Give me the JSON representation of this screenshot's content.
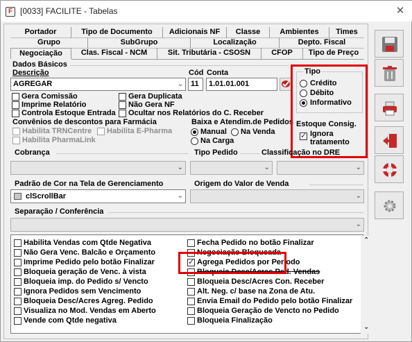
{
  "window": {
    "title": "[0033] FACILITE - Tabelas",
    "close_glyph": "✕"
  },
  "tabs": {
    "row1": [
      "Portador",
      "Tipo de Documento",
      "Adicionais NF",
      "Classe",
      "Ambientes",
      "Times"
    ],
    "row2": [
      "Grupo",
      "SubGrupo",
      "Localização",
      "Depto. Fiscal"
    ],
    "row3": [
      "Negociação",
      "Clas. Fiscal - NCM",
      "Sit. Tributária - CSOSN",
      "CFOP",
      "Tipo de Preço"
    ]
  },
  "dados": {
    "group_label": "Dados Básicos",
    "descricao_label": "Descrição",
    "descricao_value": "AGREGAR",
    "cod_label": "Cód",
    "cod_value": "11",
    "conta_label": "Conta",
    "conta_value": "1.01.01.001"
  },
  "tipo": {
    "label": "Tipo",
    "options": [
      "Crédito",
      "Débito",
      "Informativo"
    ],
    "selected": "Informativo"
  },
  "checks_left": [
    {
      "label": "Gera Comissão",
      "checked": false
    },
    {
      "label": "Imprime Relatório",
      "checked": false
    },
    {
      "label": "Controla Estoque Entrada",
      "checked": false
    }
  ],
  "checks_right": [
    {
      "label": "Gera Duplicata",
      "checked": false
    },
    {
      "label": "Não Gera NF",
      "checked": false
    },
    {
      "label": "Ocultar nos Relatórios do C. Receber",
      "checked": false
    }
  ],
  "convenios": {
    "label": "Convênios de descontos para Farmácia",
    "items": [
      "Habilita TRNCentre",
      "Habilita E-Pharma",
      "Habilita PharmaLink"
    ]
  },
  "baixa": {
    "label": "Baixa e Atendim.de Pedidos",
    "options": [
      "Manual",
      "Na Venda",
      "Na Carga"
    ],
    "selected": "Manual"
  },
  "estoque": {
    "label": "Estoque Consig.",
    "ignora_line1": "Ignora",
    "ignora_line2": "tratamento",
    "checked": true
  },
  "cobranca_label": "Cobrança",
  "tipo_pedido_label": "Tipo Pedido",
  "classificacao_label": "Classificação no DRE",
  "padrao_cor": {
    "label": "Padrão de Cor na Tela de Gerenciamento",
    "value": "clScrollBar",
    "swatch": "#c8c8c8"
  },
  "origem_label": "Origem do Valor de Venda",
  "separacao_label": "Separação / Conferência",
  "list_left": [
    "Habilita Vendas com Qtde Negativa",
    "Não Gera Venc. Balcão e Orçamento",
    "Imprime Pedido pelo botão Finalizar",
    "Bloqueia geração de Venc. à vista",
    "Bloqueia imp. do Pedido s/ Vencto",
    "Ignora Pedidos sem Vencimento",
    "Bloqueia Desc/Acres Agreg. Pedido",
    "Visualiza no Mod. Vendas em Aberto",
    "Vende com Qtde negativa"
  ],
  "list_right": [
    "Fecha Pedido no botão Finalizar",
    "Negociação Bloqueada",
    "Agrega Pedidos por Período",
    "Bloqueia Desc/Acres Ped. Vendas",
    "Bloqueia Desc/Acres Con. Receber",
    "Alt. Neg. c/ base na Zona de Atu.",
    "Envia Email do Pedido pelo botão Finalizar",
    "Bloqueia Geração de Vencto no Pedido",
    "Bloqueia Finalização"
  ],
  "list_right_checked_index": 2,
  "sidebar": [
    "save-icon",
    "trash-icon",
    "printer-icon",
    "exit-door-icon",
    "lifebuoy-icon",
    "settings-gear-icon"
  ],
  "colors": {
    "highlight": "#e00000",
    "window_bg": "#f0f0f0"
  }
}
